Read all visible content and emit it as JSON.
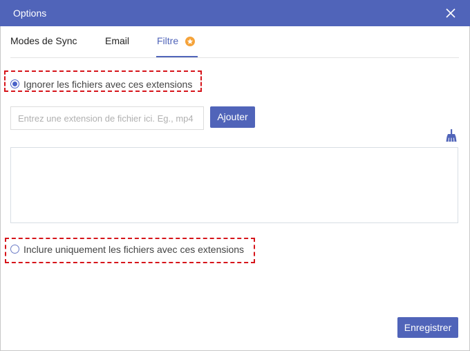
{
  "window": {
    "title": "Options",
    "close_icon": "close-icon"
  },
  "tabs": [
    {
      "label": "Modes de Sync",
      "active": false
    },
    {
      "label": "Email",
      "active": false
    },
    {
      "label": "Filtre",
      "active": true,
      "badge_icon": "star-badge-icon"
    }
  ],
  "filter": {
    "exclude_option": {
      "label": "Ignorer les fichiers avec ces extensions",
      "selected": true
    },
    "extension_input": {
      "value": "",
      "placeholder": "Entrez une extension de fichier ici. Eg., mp4"
    },
    "add_button": "Ajouter",
    "clear_icon": "broom-icon",
    "extension_list": [],
    "include_option": {
      "label": "Inclure uniquement les fichiers avec ces extensions",
      "selected": false
    }
  },
  "footer": {
    "save_button": "Enregistrer"
  },
  "colors": {
    "accent": "#5064b9",
    "highlight": "#d6141a",
    "badge": "#f5a33a"
  }
}
